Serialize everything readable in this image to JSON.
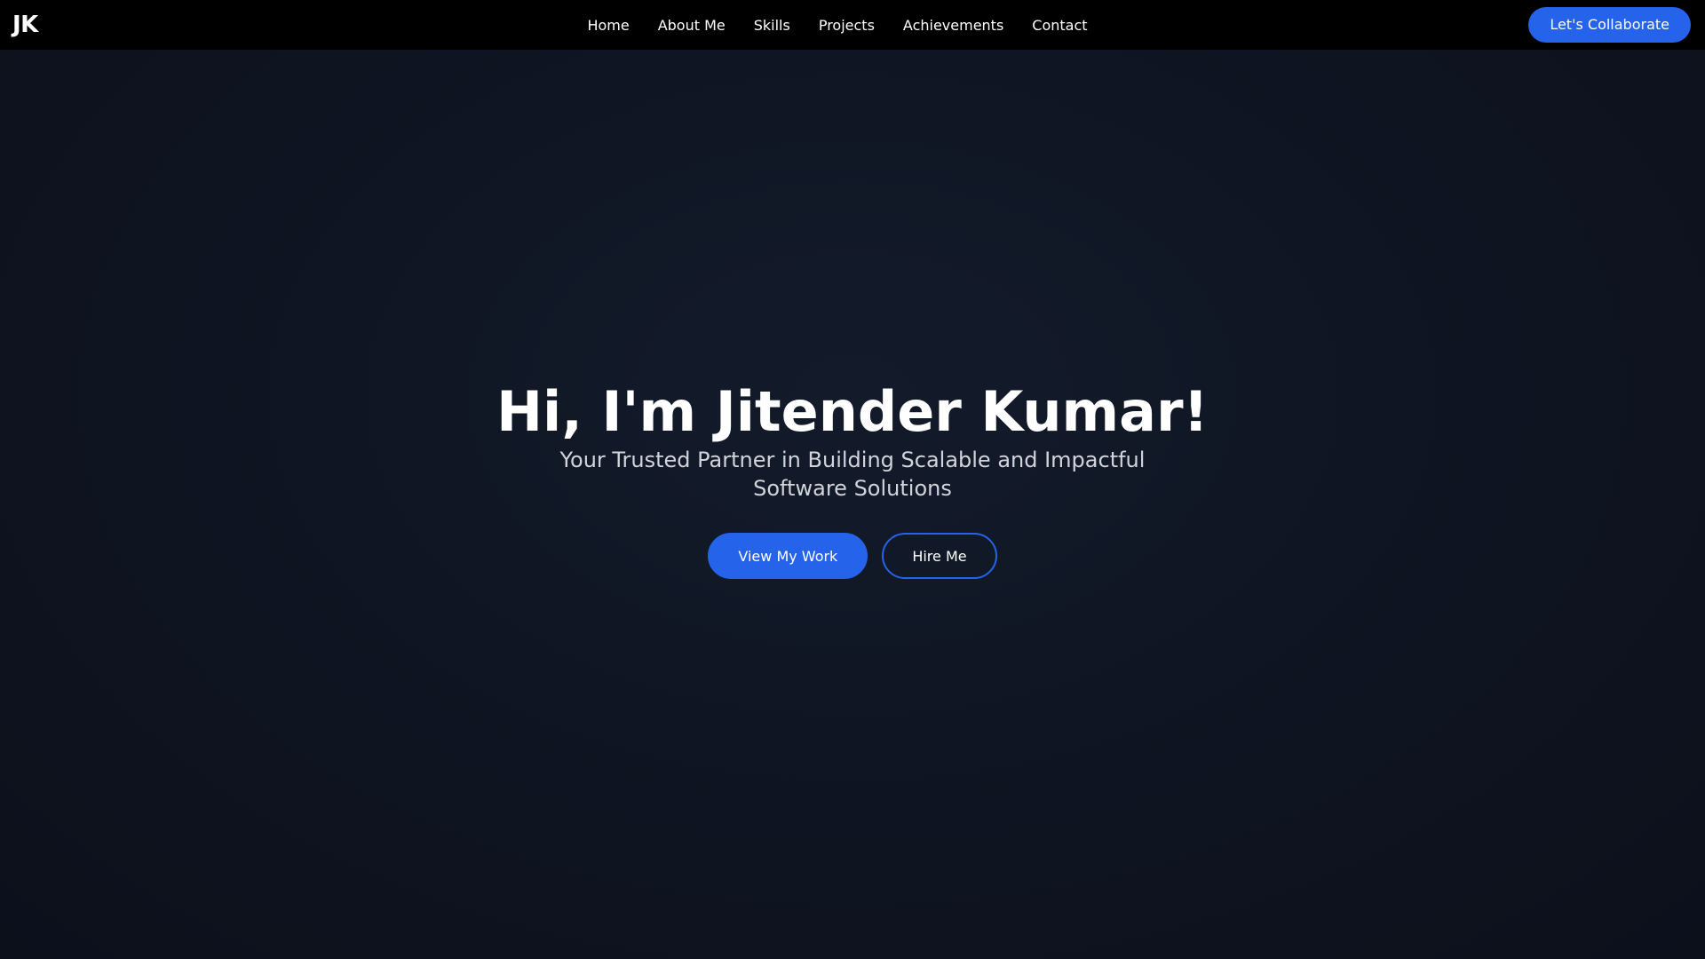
{
  "navbar": {
    "logo": "JK",
    "links": [
      "Home",
      "About Me",
      "Skills",
      "Projects",
      "Achievements",
      "Contact"
    ],
    "cta_label": "Let's Collaborate"
  },
  "hero": {
    "title": "Hi, I'm Jitender Kumar!",
    "subtitle": "Your Trusted Partner in Building Scalable and Impactful Software Solutions",
    "primary_button": "View My Work",
    "secondary_button": "Hire Me"
  },
  "colors": {
    "accent": "#2563eb",
    "navbar_bg": "#000000",
    "page_bg": "#0f1522",
    "subtitle_text": "#d1d5db"
  }
}
